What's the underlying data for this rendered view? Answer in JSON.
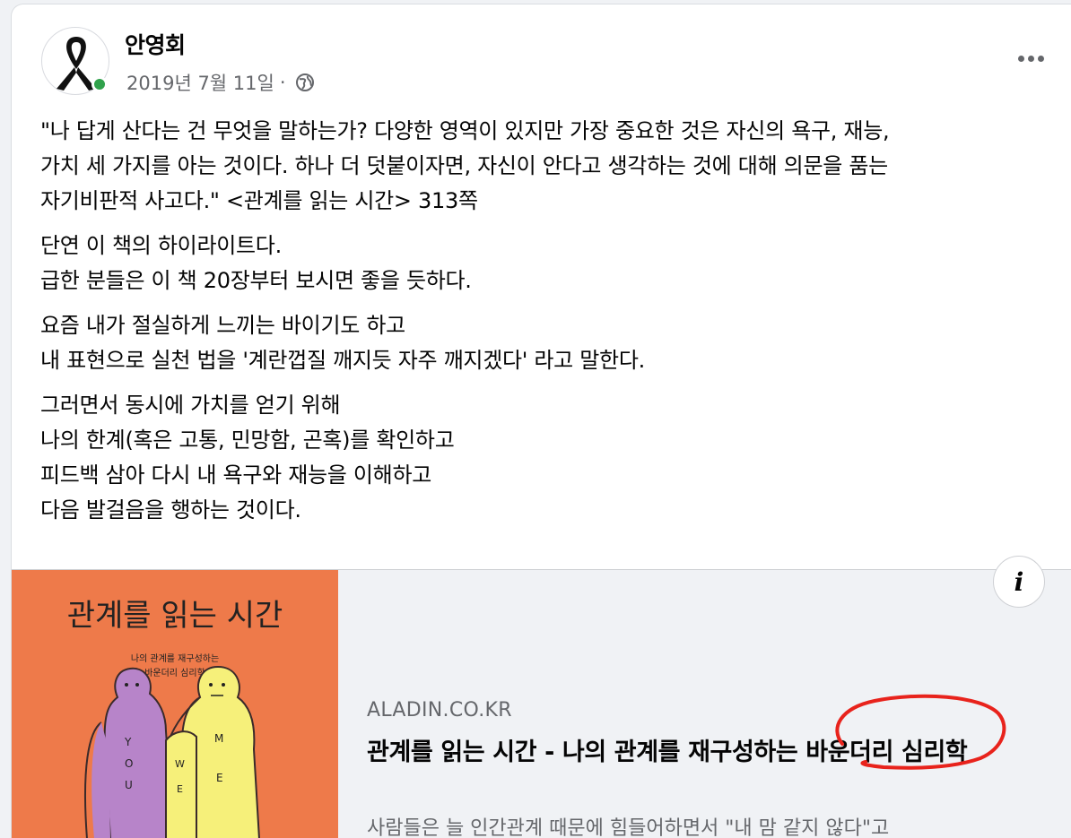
{
  "post": {
    "author": "안영회",
    "date": "2019년 7월 11일",
    "separator": "·",
    "privacy_icon": "globe-icon",
    "avatar_icon": "black-ribbon-icon",
    "online_color": "#31a24c",
    "more_icon": "more-options-icon"
  },
  "body": {
    "paragraphs": [
      [
        "\"나 답게 산다는 건 무엇을 말하는가? 다양한 영역이 있지만 가장 중요한 것은 자신의 욕구, 재능,",
        "가치 세 가지를 아는 것이다. 하나 더 덧붙이자면, 자신이 안다고 생각하는 것에 대해 의문을 품는",
        "자기비판적 사고다.\" <관계를 읽는 시간> 313쪽"
      ],
      [
        "단연 이 책의 하이라이트다.",
        "급한 분들은 이 책 20장부터 보시면 좋을 듯하다."
      ],
      [
        "요즘 내가 절실하게 느끼는 바이기도 하고",
        "내 표현으로 실천 법을 '계란껍질 깨지듯 자주 깨지겠다' 라고 말한다."
      ],
      [
        "그러면서 동시에 가치를 얻기 위해",
        "나의 한계(혹은 고통, 민망함, 곤혹)를 확인하고",
        "피드백 삼아 다시 내 욕구와 재능을 이해하고",
        "다음 발걸음을 행하는 것이다."
      ]
    ]
  },
  "link": {
    "domain": "ALADIN.CO.KR",
    "title": "관계를 읽는 시간 - 나의 관계를 재구성하는 바운더리 심리학",
    "description": "사람들은 늘 인간관계 때문에 힘들어하면서 \"내 맘 같지 않다\"고",
    "info_label": "i",
    "info_icon": "info-icon",
    "annotation_color": "#e8231c"
  },
  "book_cover": {
    "title": "관계를 읽는 시간",
    "subtitle_1": "나의 관계를 재구성하는",
    "subtitle_2": "바운더리 심리학",
    "left_figure_letters": [
      "Y",
      "O",
      "U"
    ],
    "right_figure_letters": [
      "M",
      "E"
    ],
    "arm_letters": [
      "W",
      "E"
    ],
    "background_color": "#ee7a4a"
  }
}
